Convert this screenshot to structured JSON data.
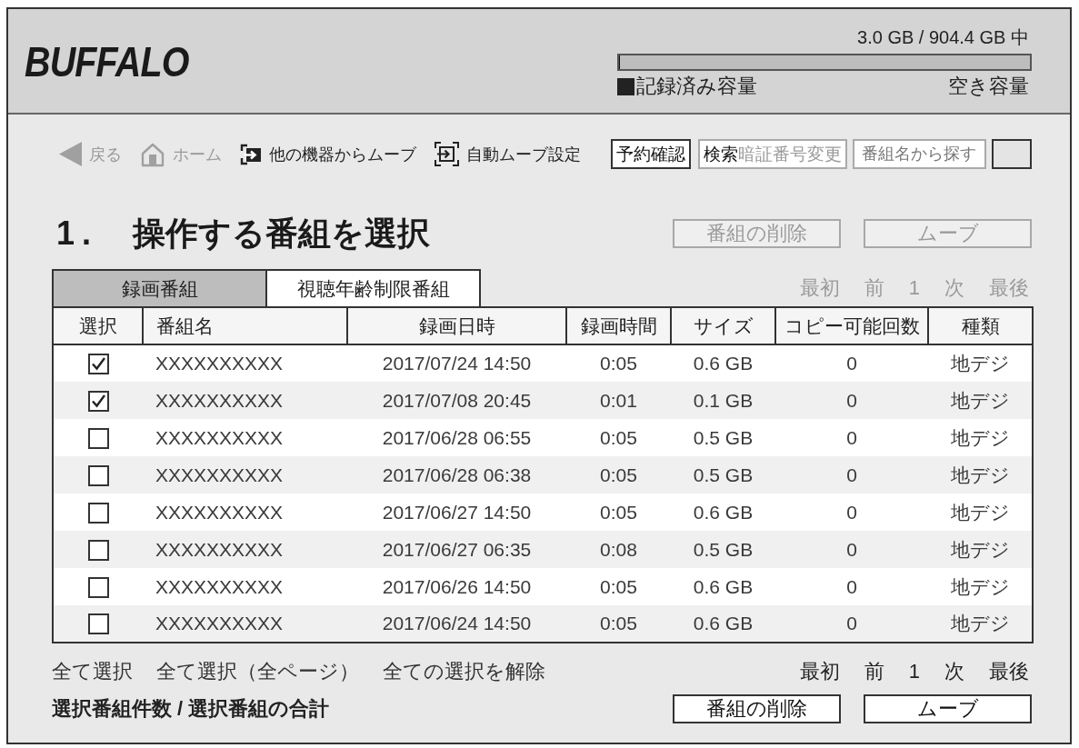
{
  "header": {
    "logo": "BUFFALO",
    "storage": {
      "usage": "3.0 GB / 904.4 GB 中",
      "level": 0.003,
      "used_label": "記録済み容量",
      "free_label": "空き容量"
    }
  },
  "nav": [
    {
      "kind": "back",
      "label": "戻る",
      "disabled": true
    },
    {
      "kind": "home",
      "label": "ホーム",
      "disabled": true
    },
    {
      "kind": "move_in",
      "label": "他の機器からムーブ",
      "disabled": false
    },
    {
      "kind": "auto_move",
      "label": "自動ムーブ設定",
      "disabled": false
    },
    {
      "kind": "button",
      "label": "予約確認",
      "disabled": false
    },
    {
      "kind": "split_button",
      "parts": [
        {
          "label": "検索",
          "disabled": false
        },
        {
          "label": "暗証番号変更",
          "disabled": true
        }
      ]
    },
    {
      "kind": "search",
      "placeholder": "番組名から探す"
    },
    {
      "kind": "blank_button"
    }
  ],
  "heading": {
    "number": "1.",
    "title": "操作する番組を選択"
  },
  "top_actions": {
    "disabled": true,
    "buttons": [
      "番組の削除",
      "ムーブ"
    ]
  },
  "tabs": [
    {
      "label": "録画番組",
      "selected": true
    },
    {
      "label": "視聴年齢制限番組",
      "selected": false
    }
  ],
  "pager_top": {
    "disabled": true,
    "items": [
      "最初",
      "前",
      "1",
      "次",
      "最後"
    ]
  },
  "table": {
    "select_column": "選択",
    "columns": [
      "番組名",
      "録画日時",
      "録画時間",
      "サイズ",
      "コピー可能回数",
      "種類"
    ],
    "rows": [
      {
        "checked": true,
        "cells": [
          "XXXXXXXXXX",
          "2017/07/24 14:50",
          "0:05",
          "0.6 GB",
          "0",
          "地デジ"
        ]
      },
      {
        "checked": true,
        "cells": [
          "XXXXXXXXXX",
          "2017/07/08 20:45",
          "0:01",
          "0.1 GB",
          "0",
          "地デジ"
        ]
      },
      {
        "checked": false,
        "cells": [
          "XXXXXXXXXX",
          "2017/06/28 06:55",
          "0:05",
          "0.5 GB",
          "0",
          "地デジ"
        ]
      },
      {
        "checked": false,
        "cells": [
          "XXXXXXXXXX",
          "2017/06/28 06:38",
          "0:05",
          "0.5 GB",
          "0",
          "地デジ"
        ]
      },
      {
        "checked": false,
        "cells": [
          "XXXXXXXXXX",
          "2017/06/27 14:50",
          "0:05",
          "0.6 GB",
          "0",
          "地デジ"
        ]
      },
      {
        "checked": false,
        "cells": [
          "XXXXXXXXXX",
          "2017/06/27 06:35",
          "0:08",
          "0.5 GB",
          "0",
          "地デジ"
        ]
      },
      {
        "checked": false,
        "cells": [
          "XXXXXXXXXX",
          "2017/06/26 14:50",
          "0:05",
          "0.6 GB",
          "0",
          "地デジ"
        ]
      },
      {
        "checked": false,
        "cells": [
          "XXXXXXXXXX",
          "2017/06/24 14:50",
          "0:05",
          "0.6 GB",
          "0",
          "地デジ"
        ]
      }
    ]
  },
  "selection_links": [
    "全て選択",
    "全て選択（全ページ）",
    "全ての選択を解除"
  ],
  "pager_bottom": {
    "disabled": false,
    "items": [
      "最初",
      "前",
      "1",
      "次",
      "最後"
    ]
  },
  "summary": "選択番組件数 / 選択番組の合計",
  "bottom_actions": {
    "disabled": false,
    "buttons": [
      "番組の削除",
      "ムーブ"
    ]
  }
}
